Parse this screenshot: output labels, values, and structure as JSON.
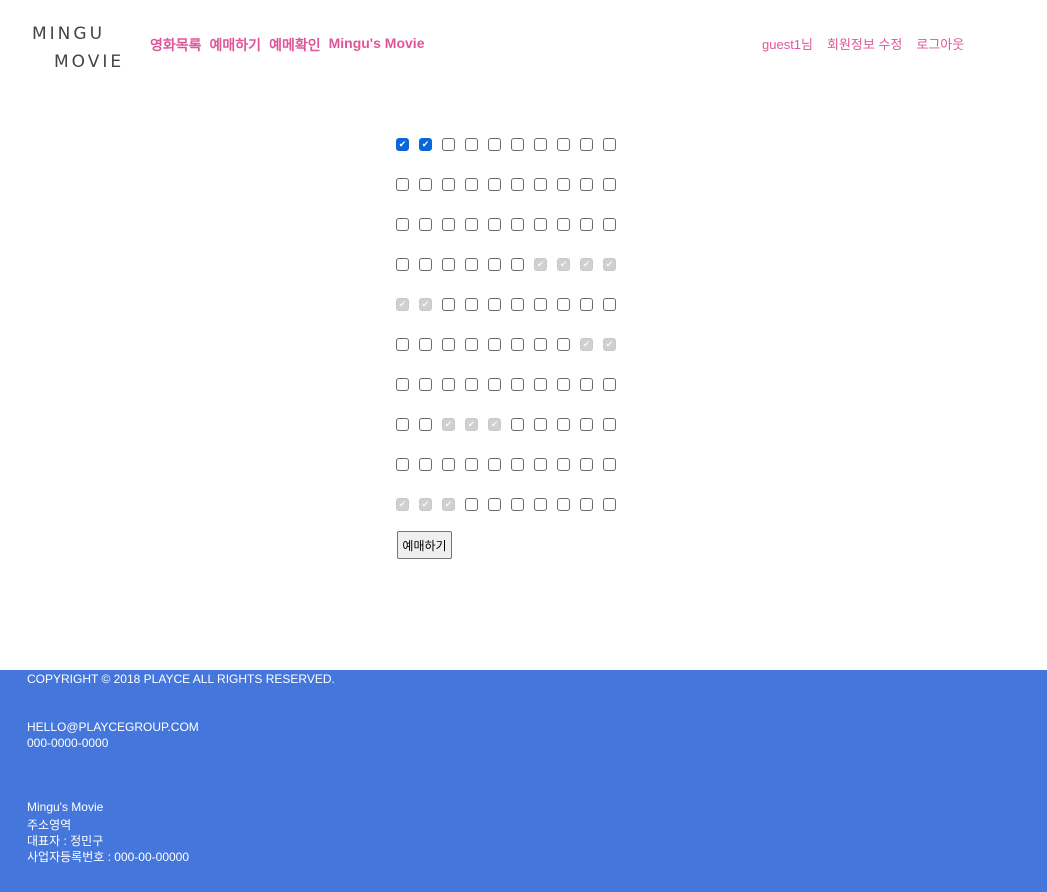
{
  "logo": {
    "line1": "MINGU",
    "line2": "MOVIE"
  },
  "nav": {
    "links": [
      "영화목록",
      "예매하기",
      "예메확인",
      "Mingu's Movie"
    ],
    "user_greeting": "guest1님",
    "edit_profile": "회원정보 수정",
    "logout": "로그아웃"
  },
  "seats": {
    "rows": [
      [
        "checked",
        "checked",
        "empty",
        "empty",
        "empty",
        "empty",
        "empty",
        "empty",
        "empty",
        "empty"
      ],
      [
        "empty",
        "empty",
        "empty",
        "empty",
        "empty",
        "empty",
        "empty",
        "empty",
        "empty",
        "empty"
      ],
      [
        "empty",
        "empty",
        "empty",
        "empty",
        "empty",
        "empty",
        "empty",
        "empty",
        "empty",
        "empty"
      ],
      [
        "empty",
        "empty",
        "empty",
        "empty",
        "empty",
        "empty",
        "reserved",
        "reserved",
        "reserved",
        "reserved"
      ],
      [
        "reserved",
        "reserved",
        "empty",
        "empty",
        "empty",
        "empty",
        "empty",
        "empty",
        "empty",
        "empty"
      ],
      [
        "empty",
        "empty",
        "empty",
        "empty",
        "empty",
        "empty",
        "empty",
        "empty",
        "reserved",
        "reserved"
      ],
      [
        "empty",
        "empty",
        "empty",
        "empty",
        "empty",
        "empty",
        "empty",
        "empty",
        "empty",
        "empty"
      ],
      [
        "empty",
        "empty",
        "reserved",
        "reserved",
        "reserved",
        "empty",
        "empty",
        "empty",
        "empty",
        "empty"
      ],
      [
        "empty",
        "empty",
        "empty",
        "empty",
        "empty",
        "empty",
        "empty",
        "empty",
        "empty",
        "empty"
      ],
      [
        "reserved",
        "reserved",
        "reserved",
        "empty",
        "empty",
        "empty",
        "empty",
        "empty",
        "empty",
        "empty"
      ]
    ]
  },
  "reserve_button": "예매하기",
  "footer": {
    "copyright": "COPYRIGHT © 2018 PLAYCE ALL RIGHTS RESERVED.",
    "email": "HELLO@PLAYCEGROUP.COM",
    "phone": "000-0000-0000",
    "company": "Mingu's Movie",
    "address": "주소영역",
    "ceo": "대표자 : 정민구",
    "business_number": "사업자등록번호 : 000-00-00000"
  }
}
